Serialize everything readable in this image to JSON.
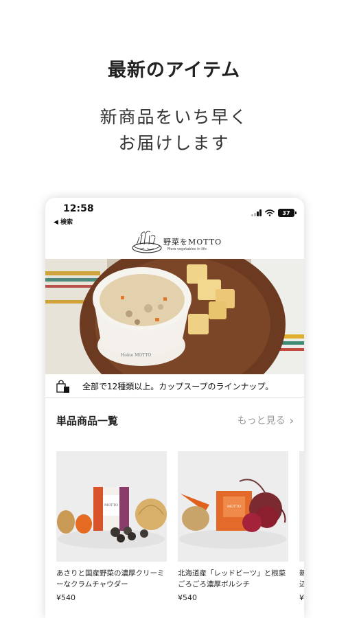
{
  "promo": {
    "title": "最新のアイテム",
    "subtitle_line1": "新商品をいち早く",
    "subtitle_line2": "お届けします"
  },
  "status_bar": {
    "time": "12:58",
    "back_label": "◀ 検索",
    "battery": "37"
  },
  "header": {
    "logo_text": "野菜をMOTTO",
    "logo_tagline": "More vegetables in life"
  },
  "banner": {
    "text": "全部で12種類以上。カップスープのラインナップ。"
  },
  "section": {
    "title": "単品商品一覧",
    "more_label": "もっと見る",
    "more_chevron": "›"
  },
  "products": [
    {
      "name": "あさりと国産野菜の濃厚クリーミーなクラムチャウダー",
      "price": "¥540"
    },
    {
      "name": "北海道産「レッドビーツ」と根菜ごろごろ濃厚ボルシチ",
      "price": "¥540"
    },
    {
      "name": "新辺",
      "price": "¥"
    }
  ],
  "colors": {
    "accent_orange": "#e07a2e",
    "beet_red": "#8c1f2e",
    "text_muted": "#999999"
  }
}
